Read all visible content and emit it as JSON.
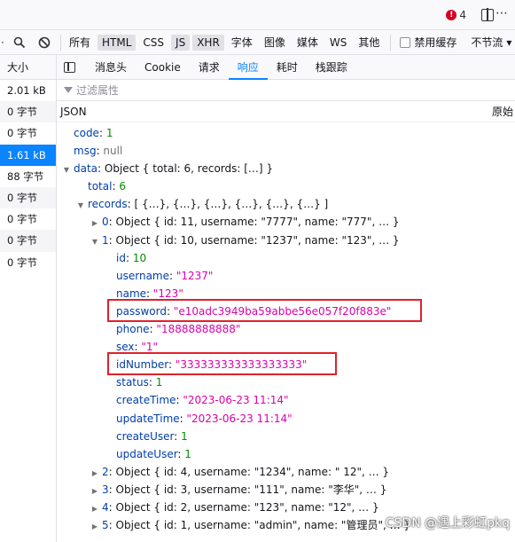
{
  "toolbar": {
    "error_count": "4",
    "error_glyph": "!",
    "more_glyph": "⋯"
  },
  "filters": {
    "items": [
      "所有",
      "HTML",
      "CSS",
      "JS",
      "XHR",
      "字体",
      "图像",
      "媒体",
      "WS",
      "其他"
    ],
    "active": [
      "HTML",
      "JS",
      "XHR"
    ],
    "disable_cache_label": "禁用缓存",
    "throttle_label": "不节流",
    "throttle_arrow": "▾"
  },
  "size_column": {
    "header": "大小",
    "cells": [
      "2.01 kB",
      "0 字节",
      "0 字节",
      "1.61 kB",
      "88 字节",
      "0 字节",
      "0 字节",
      "0 字节",
      "0 字节"
    ],
    "selected_index": 3
  },
  "tabs": [
    "消息头",
    "Cookie",
    "请求",
    "响应",
    "耗时",
    "栈跟踪"
  ],
  "active_tab": "响应",
  "filter_props_placeholder": "过滤属性",
  "json_header": {
    "label": "JSON",
    "raw_label": "原始"
  },
  "json_tree": [
    {
      "indent": 0,
      "twisty": "",
      "key": "code",
      "value": "1",
      "vtype": "n"
    },
    {
      "indent": 0,
      "twisty": "",
      "key": "msg",
      "value": "null",
      "vtype": "nl"
    },
    {
      "indent": 0,
      "twisty": "open",
      "key": "data",
      "value": "Object { total: 6, records: […] }",
      "vtype": "o"
    },
    {
      "indent": 1,
      "twisty": "",
      "key": "total",
      "value": "6",
      "vtype": "n"
    },
    {
      "indent": 1,
      "twisty": "open",
      "key": "records",
      "value": "[ {…}, {…}, {…}, {…}, {…}, {…} ]",
      "vtype": "o"
    },
    {
      "indent": 2,
      "twisty": "closed",
      "key": "0",
      "value": "Object { id: 11, username: \"7777\", name: \"777\", … }",
      "vtype": "o"
    },
    {
      "indent": 2,
      "twisty": "open",
      "key": "1",
      "value": "Object { id: 10, username: \"1237\", name: \"123\", … }",
      "vtype": "o"
    },
    {
      "indent": 3,
      "twisty": "",
      "key": "id",
      "value": "10",
      "vtype": "n"
    },
    {
      "indent": 3,
      "twisty": "",
      "key": "username",
      "value": "\"1237\"",
      "vtype": "s"
    },
    {
      "indent": 3,
      "twisty": "",
      "key": "name",
      "value": "\"123\"",
      "vtype": "s"
    },
    {
      "indent": 3,
      "twisty": "",
      "key": "password",
      "value": "\"e10adc3949ba59abbe56e057f20f883e\"",
      "vtype": "s"
    },
    {
      "indent": 3,
      "twisty": "",
      "key": "phone",
      "value": "\"18888888888\"",
      "vtype": "s"
    },
    {
      "indent": 3,
      "twisty": "",
      "key": "sex",
      "value": "\"1\"",
      "vtype": "s"
    },
    {
      "indent": 3,
      "twisty": "",
      "key": "idNumber",
      "value": "\"333333333333333333\"",
      "vtype": "s"
    },
    {
      "indent": 3,
      "twisty": "",
      "key": "status",
      "value": "1",
      "vtype": "n"
    },
    {
      "indent": 3,
      "twisty": "",
      "key": "createTime",
      "value": "\"2023-06-23 11:14\"",
      "vtype": "s"
    },
    {
      "indent": 3,
      "twisty": "",
      "key": "updateTime",
      "value": "\"2023-06-23 11:14\"",
      "vtype": "s"
    },
    {
      "indent": 3,
      "twisty": "",
      "key": "createUser",
      "value": "1",
      "vtype": "n"
    },
    {
      "indent": 3,
      "twisty": "",
      "key": "updateUser",
      "value": "1",
      "vtype": "n"
    },
    {
      "indent": 2,
      "twisty": "closed",
      "key": "2",
      "value": "Object { id: 4, username: \"1234\", name: \" 12\", … }",
      "vtype": "o"
    },
    {
      "indent": 2,
      "twisty": "closed",
      "key": "3",
      "value": "Object { id: 3, username: \"111\", name: \"李华\", … }",
      "vtype": "o"
    },
    {
      "indent": 2,
      "twisty": "closed",
      "key": "4",
      "value": "Object { id: 2, username: \"123\", name: \"12\", … }",
      "vtype": "o"
    },
    {
      "indent": 2,
      "twisty": "closed",
      "key": "5",
      "value": "Object { id: 1, username: \"admin\", name: \"管理员\", … }",
      "vtype": "o"
    }
  ],
  "highlighted_keys": [
    "password",
    "idNumber"
  ],
  "highlight_color": "#e0222b",
  "watermark": "CSDN @遇上彩虹pkq"
}
